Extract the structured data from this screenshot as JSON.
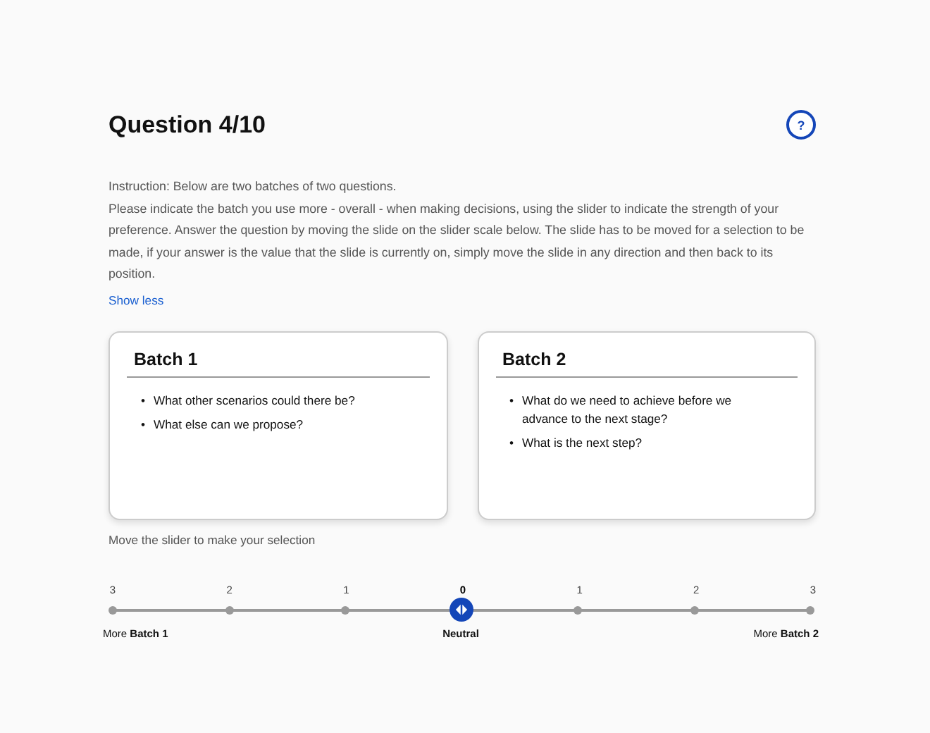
{
  "title": "Question 4/10",
  "help_button": {
    "label": "?"
  },
  "instruction": [
    "Instruction: Below are two batches of two questions.",
    "Please indicate the batch you use more - overall - when making decisions, using the slider to indicate the strength of your preference. Answer the question by moving the slide on the slider scale below. The slide has to be moved for a selection to be made, if your answer is the value that the slide is currently on, simply move the slide in any direction and then back to its position."
  ],
  "toggle_link": "Show less",
  "bullet": "•",
  "batches": [
    {
      "title": "Batch 1",
      "questions": [
        "What other scenarios could there be?",
        "What else can we propose?"
      ]
    },
    {
      "title": "Batch 2",
      "questions": [
        "What do we need to achieve before we advance to the next stage?",
        "What is the next step?"
      ]
    }
  ],
  "slider_hint": "Move the slider to make your selection",
  "slider": {
    "level": 0.5,
    "ticks": [
      {
        "label": "3",
        "selected": false
      },
      {
        "label": "2",
        "selected": false
      },
      {
        "label": "1",
        "selected": false
      },
      {
        "label": "0",
        "selected": true
      },
      {
        "label": "1",
        "selected": false
      },
      {
        "label": "2",
        "selected": false
      },
      {
        "label": "3",
        "selected": false
      }
    ],
    "left_label": "More **Batch 1**",
    "center_label": "Neutral",
    "right_label": "More **Batch 2**"
  }
}
